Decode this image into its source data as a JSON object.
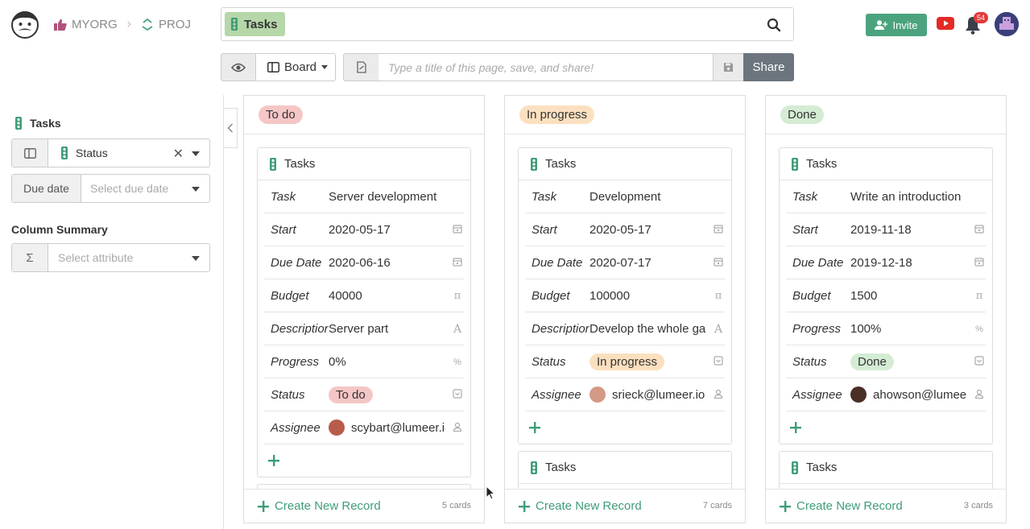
{
  "breadcrumb": {
    "org": "MYORG",
    "project": "PROJ"
  },
  "search": {
    "chip_label": "Tasks"
  },
  "header": {
    "invite_label": "Invite",
    "notification_count": "54"
  },
  "toolbar": {
    "board_label": "Board",
    "title_placeholder": "Type a title of this page, save, and share!",
    "share_label": "Share"
  },
  "sidebar": {
    "title": "Tasks",
    "group_by_value": "Status",
    "due_date_label": "Due date",
    "due_date_placeholder": "Select due date",
    "summary_title": "Column Summary",
    "summary_placeholder": "Select attribute"
  },
  "board": {
    "create_label": "Create New Record",
    "columns": [
      {
        "title": "To do",
        "color": "#f5c6c6",
        "count_label": "5 cards",
        "cards": [
          {
            "head": "Tasks",
            "fields": [
              {
                "label": "Task",
                "value": "Server development",
                "icon": ""
              },
              {
                "label": "Start",
                "value": "2020-05-17",
                "icon": "calendar-icon"
              },
              {
                "label": "Due Date",
                "value": "2020-06-16",
                "icon": "calendar-icon"
              },
              {
                "label": "Budget",
                "value": "40000",
                "icon": "pi-icon"
              },
              {
                "label": "Description",
                "value": "Server part",
                "icon": "text-icon"
              },
              {
                "label": "Progress",
                "value": "0%",
                "icon": "percent-icon"
              },
              {
                "label": "Status",
                "value": "To do",
                "icon": "select-icon"
              },
              {
                "label": "Assignee",
                "value": "scybart@lumeer.io",
                "icon": "user-icon"
              }
            ]
          },
          {
            "head": ""
          }
        ]
      },
      {
        "title": "In progress",
        "color": "#fbe0c0",
        "count_label": "7 cards",
        "cards": [
          {
            "head": "Tasks",
            "fields": [
              {
                "label": "Task",
                "value": "Development",
                "icon": ""
              },
              {
                "label": "Start",
                "value": "2020-05-17",
                "icon": "calendar-icon"
              },
              {
                "label": "Due Date",
                "value": "2020-07-17",
                "icon": "calendar-icon"
              },
              {
                "label": "Budget",
                "value": "100000",
                "icon": "pi-icon"
              },
              {
                "label": "Description",
                "value": "Develop the whole game",
                "icon": "text-icon"
              },
              {
                "label": "Status",
                "value": "In progress",
                "icon": "select-icon"
              },
              {
                "label": "Assignee",
                "value": "srieck@lumeer.io",
                "icon": "user-icon"
              }
            ]
          },
          {
            "head": "Tasks"
          }
        ]
      },
      {
        "title": "Done",
        "color": "#d4ecd4",
        "count_label": "3 cards",
        "cards": [
          {
            "head": "Tasks",
            "fields": [
              {
                "label": "Task",
                "value": "Write an introduction",
                "icon": ""
              },
              {
                "label": "Start",
                "value": "2019-11-18",
                "icon": "calendar-icon"
              },
              {
                "label": "Due Date",
                "value": "2019-12-18",
                "icon": "calendar-icon"
              },
              {
                "label": "Budget",
                "value": "1500",
                "icon": "pi-icon"
              },
              {
                "label": "Progress",
                "value": "100%",
                "icon": "percent-icon"
              },
              {
                "label": "Status",
                "value": "Done",
                "icon": "select-icon"
              },
              {
                "label": "Assignee",
                "value": "ahowson@lumeer.io",
                "icon": "user-icon"
              }
            ]
          },
          {
            "head": "Tasks"
          }
        ]
      }
    ]
  }
}
